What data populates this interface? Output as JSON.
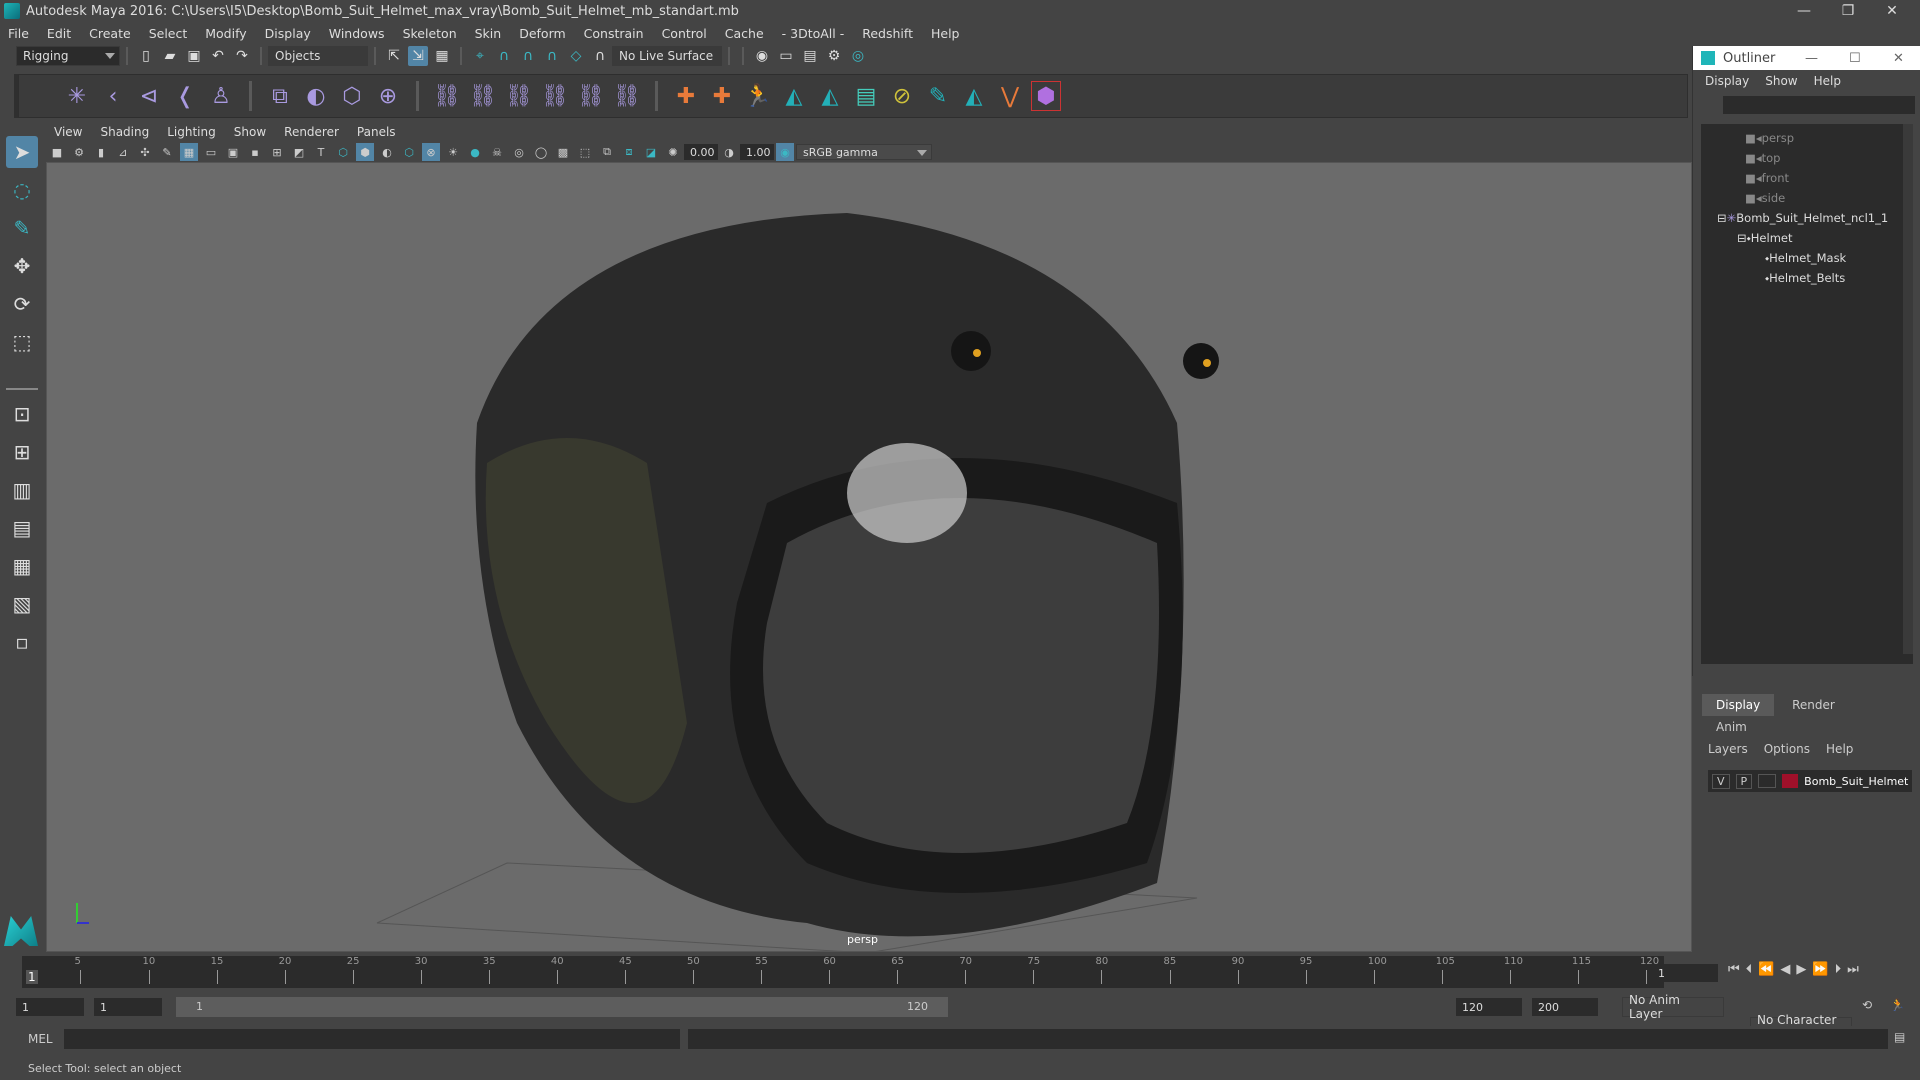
{
  "window": {
    "title": "Autodesk Maya 2016: C:\\Users\\I5\\Desktop\\Bomb_Suit_Helmet_max_vray\\Bomb_Suit_Helmet_mb_standart.mb",
    "minimize": "—",
    "restore": "❐",
    "close": "✕"
  },
  "menubar": [
    "File",
    "Edit",
    "Create",
    "Select",
    "Modify",
    "Display",
    "Windows",
    "Skeleton",
    "Skin",
    "Deform",
    "Constrain",
    "Control",
    "Cache",
    "- 3DtoAll -",
    "Redshift",
    "Help"
  ],
  "toolbar": {
    "mode": "Rigging",
    "selection_mask": "Objects",
    "live_surface": "No Live Surface"
  },
  "panel": {
    "menu": [
      "View",
      "Shading",
      "Lighting",
      "Show",
      "Renderer",
      "Panels"
    ],
    "exposure": "0.00",
    "gamma": "1.00",
    "color_space": "sRGB gamma",
    "camera_label": "persp"
  },
  "outliner": {
    "title": "Outliner",
    "menu": [
      "Display",
      "Show",
      "Help"
    ],
    "items": [
      {
        "label": "persp",
        "type": "camera"
      },
      {
        "label": "top",
        "type": "camera"
      },
      {
        "label": "front",
        "type": "camera"
      },
      {
        "label": "side",
        "type": "camera"
      },
      {
        "label": "Bomb_Suit_Helmet_ncl1_1",
        "type": "group"
      },
      {
        "label": "Helmet",
        "type": "mesh"
      },
      {
        "label": "Helmet_Mask",
        "type": "mesh"
      },
      {
        "label": "Helmet_Belts",
        "type": "mesh"
      }
    ]
  },
  "layers": {
    "tabs": [
      "Display",
      "Render",
      "Anim"
    ],
    "menu": [
      "Layers",
      "Options",
      "Help"
    ],
    "layer": {
      "v": "V",
      "p": "P",
      "name": "Bomb_Suit_Helmet",
      "color": "#a0102a"
    }
  },
  "timeline": {
    "ticks": [
      "5",
      "10",
      "15",
      "20",
      "25",
      "30",
      "35",
      "40",
      "45",
      "50",
      "55",
      "60",
      "65",
      "70",
      "75",
      "80",
      "85",
      "90",
      "95",
      "100",
      "105",
      "110",
      "115",
      "120"
    ],
    "current": "1",
    "current_field": "1"
  },
  "range": {
    "start": "1",
    "start2": "1",
    "slider_start": "1",
    "slider_end": "120",
    "end": "120",
    "end2": "200",
    "anim_layer": "No Anim Layer",
    "char_set": "No Character Set"
  },
  "cmd": {
    "label": "MEL"
  },
  "help": "Select Tool: select an object",
  "colors": {
    "accent": "#5285a6",
    "layer": "#a0102a"
  }
}
